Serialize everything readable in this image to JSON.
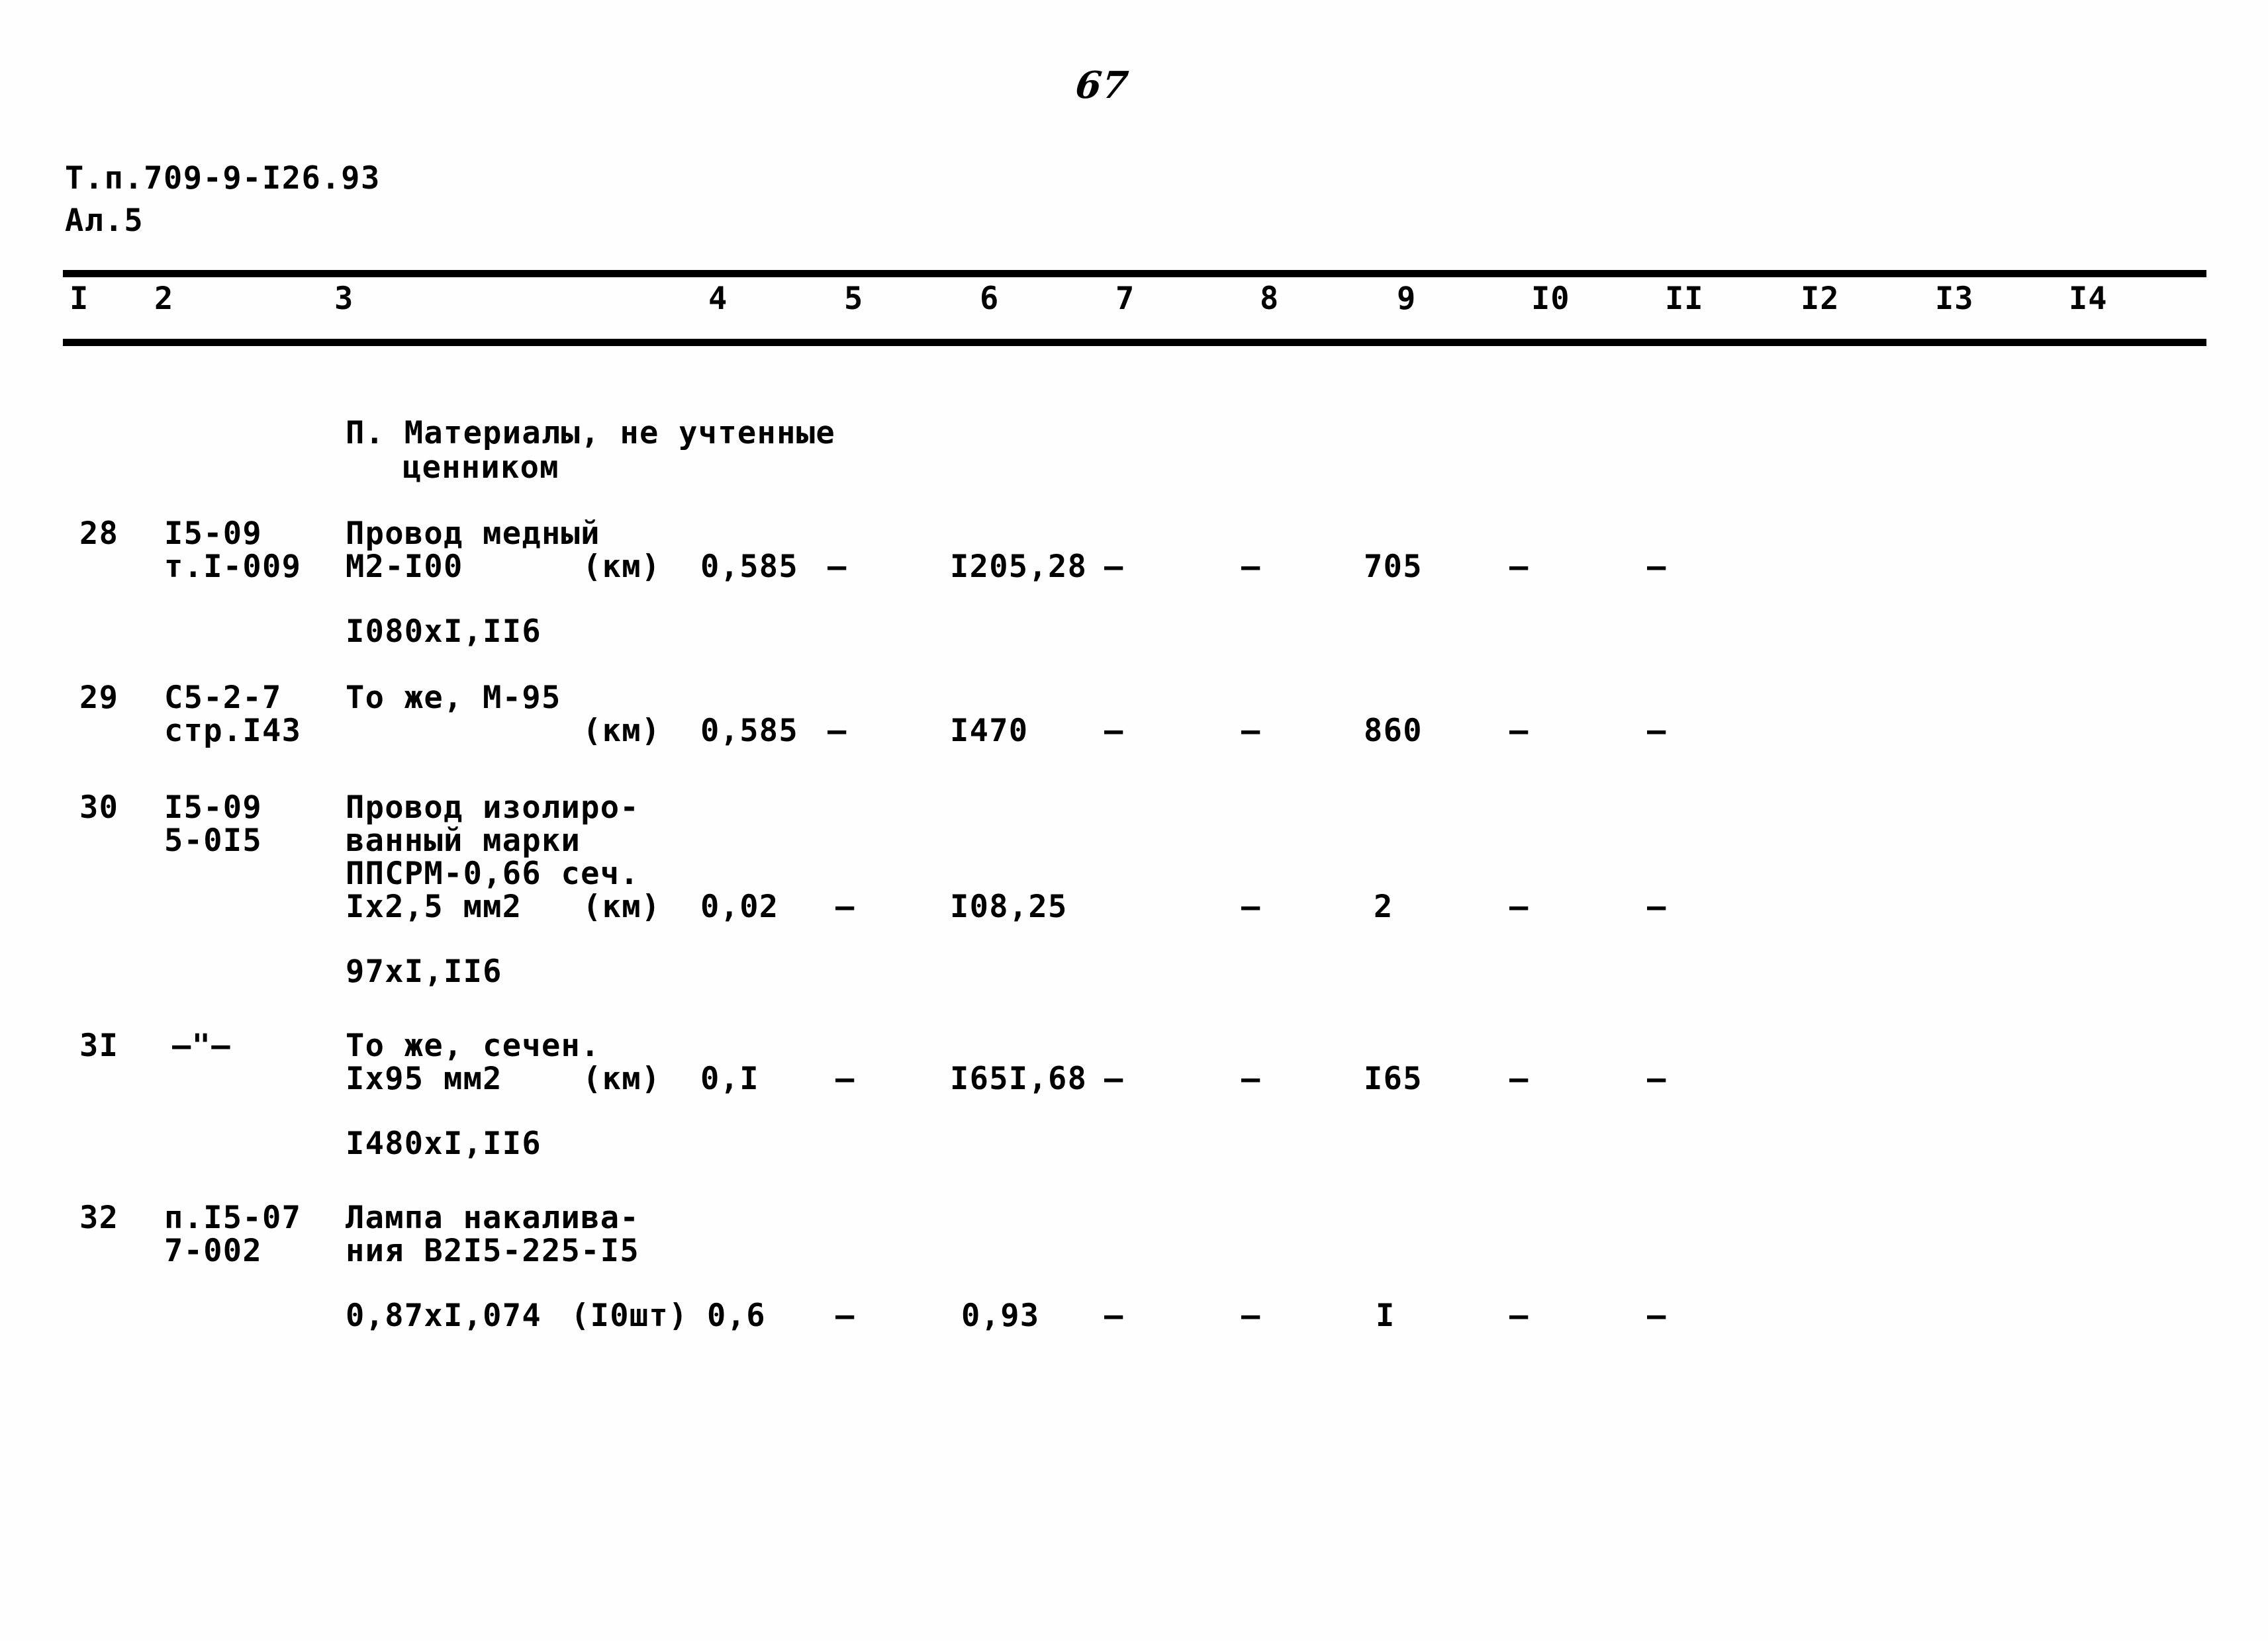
{
  "page": {
    "number": "67",
    "doc_code": "Т.п.709-9-I26.93",
    "sheet": "Ал.5"
  },
  "table": {
    "column_headers": [
      "I",
      "2",
      "3",
      "4",
      "5",
      "6",
      "7",
      "8",
      "9",
      "I0",
      "II",
      "I2",
      "I3",
      "I4"
    ],
    "section_title_line1": "П. Материалы, не учтенные",
    "section_title_line2": "ценником",
    "rows": [
      {
        "num": "28",
        "code_line1": "I5-09",
        "code_line2": "т.I-009",
        "desc_line1": "Провод медный",
        "desc_line2": "М2-I00",
        "unit": "(км)",
        "c4": "0,585",
        "c5": "–",
        "c6": "I205,28",
        "c7": "–",
        "c8": "–",
        "c9": "705",
        "c10": "–",
        "c11": "–",
        "c12": "",
        "c13": "",
        "c14": "",
        "note": "I080хI,II6"
      },
      {
        "num": "29",
        "code_line1": "С5-2-7",
        "code_line2": "стр.I43",
        "desc_line1": "То же, М-95",
        "desc_line2": "",
        "unit": "(км)",
        "c4": "0,585",
        "c5": "–",
        "c6": "I470",
        "c7": "–",
        "c8": "–",
        "c9": "860",
        "c10": "–",
        "c11": "–",
        "c12": "",
        "c13": "",
        "c14": "",
        "note": ""
      },
      {
        "num": "30",
        "code_line1": "I5-09",
        "code_line2": "5-0I5",
        "desc_line1": "Провод изолиро-",
        "desc_line2": "ванный марки",
        "desc_line3": "ППСРМ-0,66 сеч.",
        "desc_line4": "Iх2,5 мм2",
        "unit": "(км)",
        "c4": "0,02",
        "c5": "–",
        "c6": "I08,25",
        "c7": "",
        "c8": "–",
        "c9": "2",
        "c10": "–",
        "c11": "–",
        "c12": "",
        "c13": "",
        "c14": "",
        "note": "97хI,II6"
      },
      {
        "num": "3I",
        "code_line1": "–\"–",
        "code_line2": "",
        "desc_line1": "То же, сечен.",
        "desc_line2": "Iх95 мм2",
        "unit": "(км)",
        "c4": "0,I",
        "c5": "–",
        "c6": "I65I,68",
        "c7": "–",
        "c8": "–",
        "c9": "I65",
        "c10": "–",
        "c11": "–",
        "c12": "",
        "c13": "",
        "c14": "",
        "note": "I480хI,II6"
      },
      {
        "num": "32",
        "code_line1": "п.I5-07",
        "code_line2": "7-002",
        "desc_line1": "Лампа накалива-",
        "desc_line2": "ния В2I5-225-I5",
        "unit": "(I0шт)",
        "coef": "0,87хI,074",
        "c4": "0,6",
        "c5": "–",
        "c6": "0,93",
        "c7": "–",
        "c8": "–",
        "c9": "I",
        "c10": "–",
        "c11": "–",
        "c12": "",
        "c13": "",
        "c14": "",
        "note": ""
      }
    ]
  }
}
